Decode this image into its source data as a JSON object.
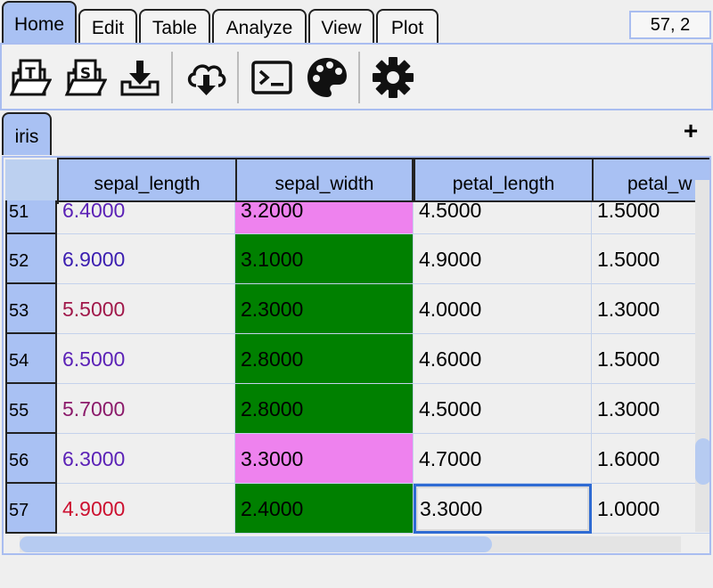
{
  "menu": {
    "tabs": [
      {
        "label": "Home",
        "active": true
      },
      {
        "label": "Edit"
      },
      {
        "label": "Table"
      },
      {
        "label": "Analyze"
      },
      {
        "label": "View"
      },
      {
        "label": "Plot"
      }
    ],
    "coordinate_readout": "57,  2"
  },
  "toolbar": {
    "icons": [
      "open-text-file-icon",
      "open-sas-file-icon",
      "download-tray-icon",
      "cloud-download-icon",
      "terminal-icon",
      "palette-icon",
      "gear-icon"
    ]
  },
  "sheet": {
    "tab_label": "iris",
    "add_label": "+"
  },
  "colors": {
    "purple_text": "#5b21b6",
    "crimson_text": "#a0184a",
    "red_text": "#cc1030",
    "green_fill": "#008000",
    "pink_fill": "#ee82ee",
    "header_blue": "#a9c1f3"
  },
  "table": {
    "columns": [
      "sepal_length",
      "sepal_width",
      "petal_length",
      "petal_w"
    ],
    "rows": [
      {
        "index": "51",
        "sepal_length": "6.4000",
        "sepal_width": "3.2000",
        "petal_length": "4.5000",
        "petal_width": "1.5000",
        "sl_color": "#5b21b6",
        "sw_fill": "#ee82ee"
      },
      {
        "index": "52",
        "sepal_length": "6.9000",
        "sepal_width": "3.1000",
        "petal_length": "4.9000",
        "petal_width": "1.5000",
        "sl_color": "#3b1db0",
        "sw_fill": "#008000"
      },
      {
        "index": "53",
        "sepal_length": "5.5000",
        "sepal_width": "2.3000",
        "petal_length": "4.0000",
        "petal_width": "1.3000",
        "sl_color": "#a0184a",
        "sw_fill": "#008000"
      },
      {
        "index": "54",
        "sepal_length": "6.5000",
        "sepal_width": "2.8000",
        "petal_length": "4.6000",
        "petal_width": "1.5000",
        "sl_color": "#5b21b6",
        "sw_fill": "#008000"
      },
      {
        "index": "55",
        "sepal_length": "5.7000",
        "sepal_width": "2.8000",
        "petal_length": "4.5000",
        "petal_width": "1.3000",
        "sl_color": "#8b1a6a",
        "sw_fill": "#008000"
      },
      {
        "index": "56",
        "sepal_length": "6.3000",
        "sepal_width": "3.3000",
        "petal_length": "4.7000",
        "petal_width": "1.6000",
        "sl_color": "#5b21b6",
        "sw_fill": "#ee82ee"
      },
      {
        "index": "57",
        "sepal_length": "4.9000",
        "sepal_width": "2.4000",
        "petal_length": "3.3000",
        "petal_width": "1.0000",
        "sl_color": "#cc1030",
        "sw_fill": "#008000"
      }
    ],
    "selected": {
      "row": "57",
      "column": "petal_length"
    }
  }
}
